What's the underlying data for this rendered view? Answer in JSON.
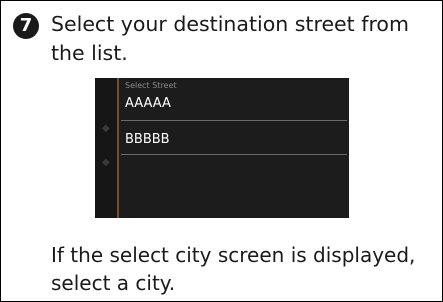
{
  "step": {
    "number": "7",
    "text_line1": "Select your destination street from",
    "text_line2": "the list."
  },
  "screen": {
    "header": "Select Street",
    "items": [
      {
        "label": "AAAAA"
      },
      {
        "label": "BBBBB"
      }
    ],
    "arrow_up": "◆",
    "arrow_down": "◆",
    "colors": {
      "background": "#1c1c1c",
      "accent_line": "#7a4a2a",
      "text": "#ffffff"
    }
  },
  "note": {
    "line1": "If the select city screen is displayed,",
    "line2": "select a city."
  }
}
